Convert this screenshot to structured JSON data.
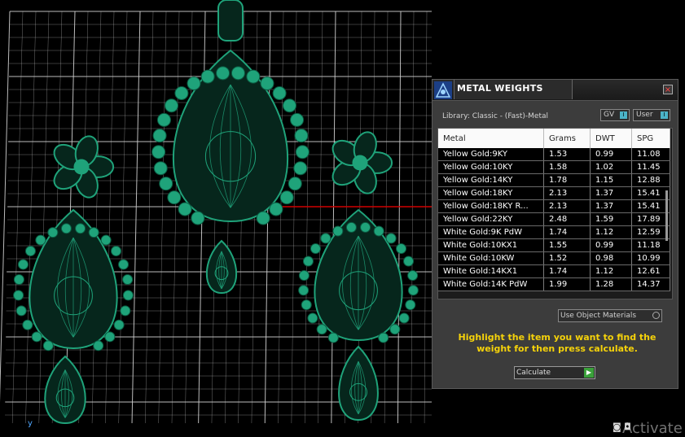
{
  "panel": {
    "title": "METAL WEIGHTS",
    "close_label": "×",
    "library_label": "Library: Classic - (Fast)-Metal",
    "toggles": [
      {
        "label": "GV",
        "state": "I"
      },
      {
        "label": "User",
        "state": "I"
      }
    ],
    "table": {
      "headers": [
        "Metal",
        "Grams",
        "DWT",
        "SPG"
      ],
      "rows": [
        [
          "Yellow Gold:9KY",
          "1.53",
          "0.99",
          "11.08"
        ],
        [
          "Yellow Gold:10KY",
          "1.58",
          "1.02",
          "11.45"
        ],
        [
          "Yellow Gold:14KY",
          "1.78",
          "1.15",
          "12.88"
        ],
        [
          "Yellow Gold:18KY",
          "2.13",
          "1.37",
          "15.41"
        ],
        [
          "Yellow Gold:18KY R...",
          "2.13",
          "1.37",
          "15.41"
        ],
        [
          "Yellow Gold:22KY",
          "2.48",
          "1.59",
          "17.89"
        ],
        [
          "White Gold:9K PdW",
          "1.74",
          "1.12",
          "12.59"
        ],
        [
          "White Gold:10KX1",
          "1.55",
          "0.99",
          "11.18"
        ],
        [
          "White Gold:10KW",
          "1.52",
          "0.98",
          "10.99"
        ],
        [
          "White Gold:14KX1",
          "1.74",
          "1.12",
          "12.61"
        ],
        [
          "White Gold:14K PdW",
          "1.99",
          "1.28",
          "14.37"
        ]
      ]
    },
    "use_object_materials": "Use Object Materials",
    "hint": "Highlight the item you want to find the weight for then press calculate.",
    "calculate_label": "Calculate"
  },
  "viewport": {
    "axis_label": "y",
    "watermark": "Activate",
    "model_color": "#1fa37a",
    "grid_color": "#d0d0d0",
    "axis_line_color": "#d00000"
  }
}
